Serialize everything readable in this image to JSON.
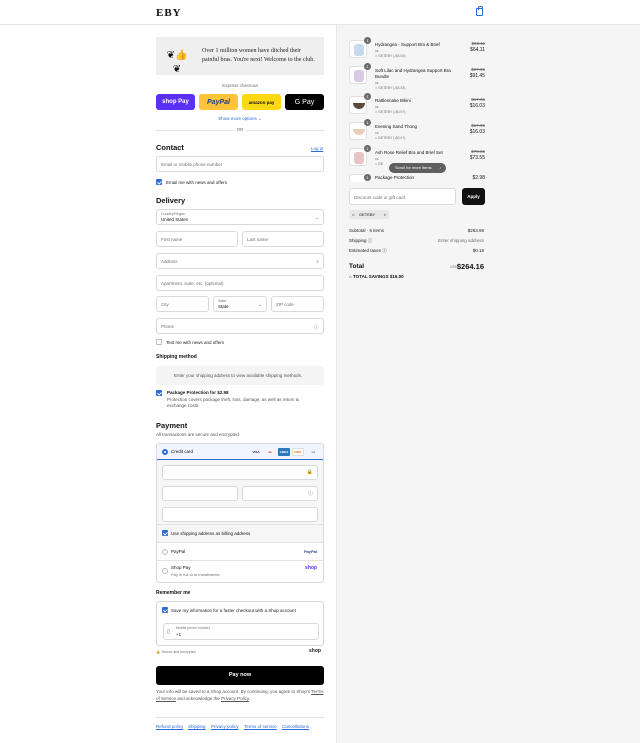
{
  "header": {
    "logo": "EBY",
    "cart_icon": "shopping-bag-icon"
  },
  "promo": {
    "icon": "laurel-thumbs-up-icon",
    "text": "Over 1 million women have ditched their painful bras. You're next! Welcome to the club."
  },
  "express": {
    "title": "Express checkout",
    "buttons": [
      {
        "label": "shop Pay",
        "color": "#5a31f4"
      },
      {
        "label": "PayPal",
        "color": "#ffc439"
      },
      {
        "label": "amazon pay",
        "color": "#ffd814"
      },
      {
        "label": "G Pay",
        "color": "#000000"
      }
    ],
    "show_more": "Show more options ⌄",
    "or": "OR"
  },
  "contact": {
    "title": "Contact",
    "login": "Log in",
    "email_placeholder": "Email or mobile phone number",
    "news_label": "Email me with news and offers",
    "news_checked": true
  },
  "delivery": {
    "title": "Delivery",
    "country_label": "Country/Region",
    "country_value": "United States",
    "first_name": "First name",
    "last_name": "Last name",
    "address": "Address",
    "apartment": "Apartment, suite, etc. (optional)",
    "city": "City",
    "state_label": "State",
    "state_value": "State",
    "zip": "ZIP code",
    "phone": "Phone",
    "text_label": "Text me with news and offers"
  },
  "shipping": {
    "title": "Shipping method",
    "notice": "Enter your shipping address to view available shipping methods."
  },
  "protection": {
    "title": "Package Protection for $2.98",
    "desc": "Protection covers package theft, loss, damage, as well as return & exchange costs."
  },
  "payment": {
    "title": "Payment",
    "subtitle": "All transactions are secure and encrypted.",
    "credit_card": "Credit card",
    "cards": [
      "VISA",
      "MC",
      "AMEX",
      "DISC",
      "+4"
    ],
    "billing_label": "Use shipping address as billing address",
    "paypal": "PayPal",
    "paypal_logo": "PayPal",
    "shoppay": "Shop Pay",
    "shoppay_sub": "Pay in full or in installments",
    "shoppay_logo": "shop"
  },
  "remember": {
    "title": "Remember me",
    "save_label": "Save my information for a faster checkout with a Shop account",
    "phone_label": "Mobile phone number",
    "phone_value": "+1",
    "secure": "Secure and encrypted",
    "shop_logo": "shop"
  },
  "paynow": "Pay now",
  "terms": {
    "before": "Your info will be saved to a Shop account. By continuing, you agree to Shop's",
    "tos": "Terms of Service",
    "mid": " and acknowledge the ",
    "privacy": "Privacy Policy",
    "end": "."
  },
  "footer_links": [
    "Refund policy",
    "Shipping",
    "Privacy policy",
    "Terms of service",
    "Cancellations"
  ],
  "summary": {
    "items": [
      {
        "qty": "1",
        "name": "Hydrangea - Support Bra & Brief",
        "variant": "xs",
        "discount": "GETEBY (-$5.00)",
        "old": "$69.11",
        "new": "$64.11",
        "thumb": "#c9d8ee"
      },
      {
        "qty": "1",
        "name": "Soft Lilac and Hydrangea Support Bra Bundle",
        "variant": "xs",
        "discount": "GETEBY (-$3.33)",
        "old": "$97.06",
        "new": "$91.45",
        "thumb": "#d9cbe8"
      },
      {
        "qty": "1",
        "name": "Rattlesnake Bikini",
        "variant": "xs",
        "discount": "GETEBY (-$0.97)",
        "old": "$17.06",
        "new": "$16.03",
        "thumb": "#5a4a3c"
      },
      {
        "qty": "1",
        "name": "Evening Sand Thong",
        "variant": "xs",
        "discount": "GETEBY (-$0.97)",
        "old": "$17.06",
        "new": "$16.03",
        "thumb": "#e9cdbb"
      },
      {
        "qty": "1",
        "name": "Ash Rose Relief Bra and Brief Set",
        "variant": "xs",
        "discount": "GE",
        "old": "$78.56",
        "new": "$73.55",
        "thumb": "#e8c4c8"
      },
      {
        "qty": "1",
        "name": "Package Protection",
        "variant": "",
        "discount": "",
        "old": "",
        "new": "$2.98",
        "thumb": "#f0f0f0"
      }
    ],
    "scroll_hint": "Scroll for more items",
    "discount_placeholder": "Discount code or gift card",
    "apply": "Apply",
    "code": "GETEBY",
    "subtotal_label": "Subtotal · 6 items",
    "subtotal_value": "$263.98",
    "shipping_label": "Shipping",
    "shipping_value": "Enter shipping address",
    "taxes_label": "Estimated taxes",
    "taxes_value": "$0.18",
    "total_label": "Total",
    "currency": "USD",
    "total_value": "$264.16",
    "savings": "TOTAL SAVINGS  $16.00"
  }
}
